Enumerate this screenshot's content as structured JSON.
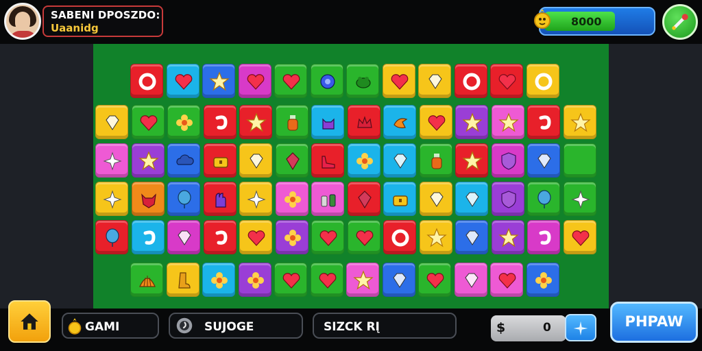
{
  "player": {
    "name": "SABENI DPOSZDO:",
    "subtitle": "Uaanidg",
    "avatar_icon": "player-portrait"
  },
  "currency": {
    "value": "8000",
    "icon": "coin-icon",
    "fill_fraction": 0.62
  },
  "settings": {
    "icon": "wrench-icon"
  },
  "board": {
    "background_color": "#11822a",
    "rows": [
      [
        "red:ring",
        "cyan:heart",
        "blue:star",
        "magenta:heart",
        "green:heart",
        "green:gear",
        "green:frog",
        "yellow:heart",
        "yellow:gem",
        "red:ring",
        "red:heart",
        "yellow:ring"
      ],
      [
        "yellow:gem",
        "green:heart",
        "green:flower",
        "red:hook",
        "red:star",
        "green:bottle",
        "cyan:cat",
        "red:crown",
        "cyan:bird",
        "yellow:heart",
        "purple:star",
        "pink:star",
        "red:hook",
        "yellow:star"
      ],
      [
        "pink:sparkle",
        "purple:star",
        "blue:cloud",
        "red:chest",
        "yellow:gem",
        "green:crystal",
        "red:shoe",
        "cyan:flower",
        "cyan:gem",
        "green:bottle",
        "red:star",
        "magenta:shield",
        "blue:gem",
        "green:blank"
      ],
      [
        "yellow:sparkle",
        "orange:fox",
        "blue:balloon",
        "red:glove",
        "yellow:sparkle",
        "pink:flower",
        "pink:bottles",
        "red:crystal",
        "cyan:chest",
        "yellow:gem",
        "cyan:gem",
        "purple:shield",
        "green:balloon",
        "green:sparkle"
      ],
      [
        "red:balloon",
        "cyan:hook",
        "magenta:gem",
        "red:hook",
        "yellow:heart",
        "purple:flower",
        "green:heart",
        "green:heart",
        "red:ring",
        "yellow:star",
        "blue:gem",
        "purple:star",
        "magenta:hook",
        "yellow:heart"
      ],
      [
        "green:shell",
        "yellow:boot",
        "cyan:flower",
        "purple:flower",
        "green:heart",
        "green:heart",
        "pink:star",
        "blue:gem",
        "green:heart",
        "pink:gem",
        "pink:heart",
        "blue:flower"
      ]
    ]
  },
  "bottom": {
    "home_icon": "home-icon",
    "game_label": "GAMI",
    "game_icon": "coin-icon",
    "score_label": "SUJOGE",
    "score_icon": "swirl-icon",
    "stack_label": "SIZCK RĮ",
    "money_symbol": "$",
    "money_value": "0",
    "plus_icon": "sparkle-icon",
    "action_label": "PHPAW"
  },
  "colors": {
    "red": "#e8202a",
    "cyan": "#1bb4ea",
    "blue": "#2c6ee8",
    "magenta": "#d83ac8",
    "green": "#2ab52c",
    "yellow": "#f6c51a",
    "purple": "#9a3ed6",
    "pink": "#ee5ad4",
    "orange": "#f08a1a"
  }
}
